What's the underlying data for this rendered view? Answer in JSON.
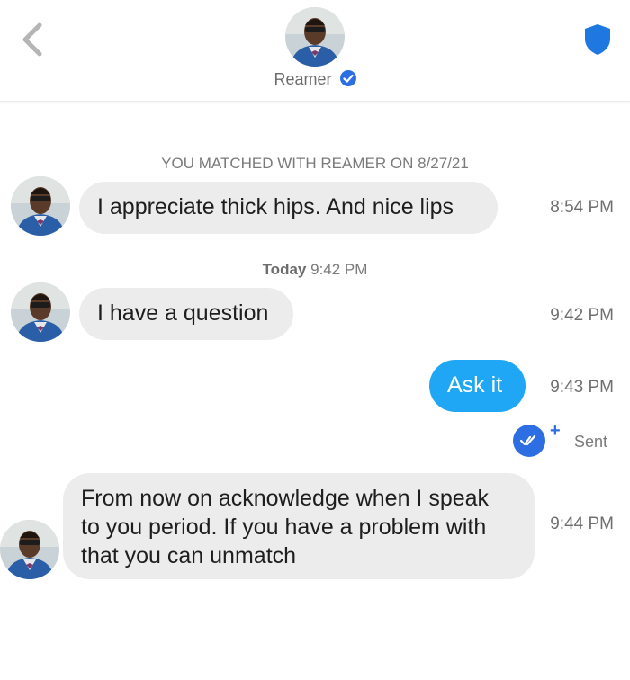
{
  "header": {
    "name": "Reamer",
    "verified_icon": "verified-check-icon",
    "back_icon": "chevron-left-icon",
    "safety_icon": "shield-icon",
    "accent_color": "#1fa7f5",
    "verified_color": "#2d6ee3"
  },
  "conversation": {
    "match_notice": "YOU MATCHED WITH REAMER ON 8/27/21",
    "separator_day": "Today",
    "separator_time": "9:42 PM",
    "messages": [
      {
        "direction": "incoming",
        "text": "I appreciate thick hips. And nice lips",
        "time": "8:54 PM"
      },
      {
        "direction": "incoming",
        "text": "I have a question",
        "time": "9:42 PM"
      },
      {
        "direction": "outgoing",
        "text": "Ask it",
        "time": "9:43 PM",
        "status": "Sent"
      },
      {
        "direction": "incoming",
        "lines": [
          "From now on acknowledge when I speak",
          "to you period. If you have a problem with",
          "that you can unmatch"
        ],
        "time": "9:44 PM"
      }
    ],
    "status_plus": "+"
  }
}
